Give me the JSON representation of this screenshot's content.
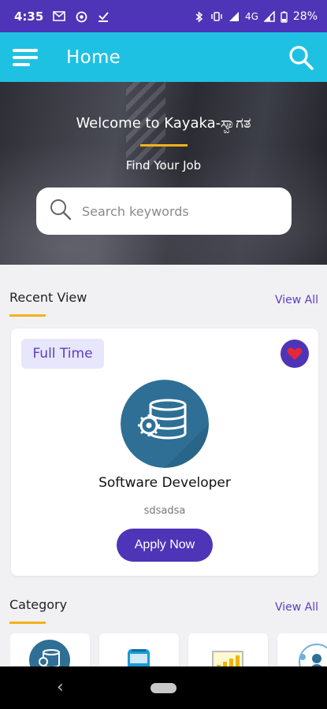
{
  "status_bar": {
    "time": "4:35",
    "left_icons": [
      "gmail-icon",
      "ring-icon",
      "download-done-icon"
    ],
    "right_icons": [
      "bluetooth-icon",
      "vibrate-icon",
      "signal-icon",
      "signal-icon",
      "battery-icon"
    ],
    "network": "4G",
    "battery": "28%"
  },
  "app_bar": {
    "title": "Home",
    "menu_icon": "hamburger-menu-icon",
    "search_icon": "search-icon",
    "color": "#1fc1e3"
  },
  "hero": {
    "title": "Welcome to Kayaka-ಸ್ವಾಗತ",
    "subtitle": "Find Your Job",
    "search_placeholder": "Search keywords",
    "accent": "#f3b21b"
  },
  "recent": {
    "title": "Recent View",
    "view_all": "View All",
    "job": {
      "type_badge": "Full Time",
      "title": "Software Developer",
      "company": "sdsadsa",
      "apply_label": "Apply Now",
      "favorite_icon": "heart-icon",
      "logo_icon": "database-gear-icon"
    }
  },
  "category": {
    "title": "Category",
    "view_all": "View All",
    "items": [
      {
        "icon": "database-gear-icon"
      },
      {
        "icon": "bus-icon"
      },
      {
        "icon": "bar-chart-icon"
      },
      {
        "icon": "people-network-icon"
      }
    ]
  },
  "nav_bar": {
    "back_icon": "back-icon",
    "home_icon": "home-pill-icon"
  },
  "colors": {
    "primary": "#4e34b6",
    "accent": "#f3b21b",
    "app_bar": "#1fc1e3"
  }
}
